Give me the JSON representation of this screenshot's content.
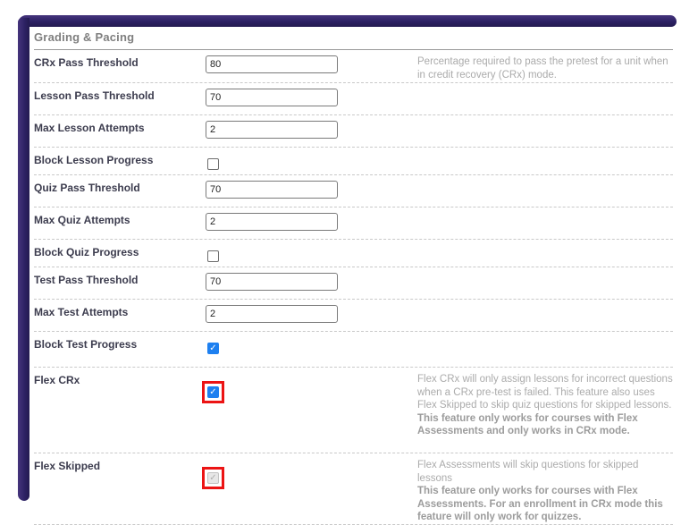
{
  "colors": {
    "frame_purple": "#2c2163",
    "checkbox_blue": "#1e80f0",
    "highlight_red": "#ec1414",
    "label_text": "#3c3c4e",
    "help_text": "#ababab",
    "title_text": "#7f7f7f"
  },
  "panel": {
    "title": "Grading & Pacing",
    "rows": [
      {
        "id": "crx_pass_threshold",
        "label": "CRx Pass Threshold",
        "type": "text",
        "value": "80",
        "help": [
          {
            "text": "Percentage required to pass the pretest for a unit when in credit recovery (CRx) mode.",
            "bold": false
          }
        ]
      },
      {
        "id": "lesson_pass_threshold",
        "label": "Lesson Pass Threshold",
        "type": "text",
        "value": "70",
        "help": []
      },
      {
        "id": "max_lesson_attempts",
        "label": "Max Lesson Attempts",
        "type": "text",
        "value": "2",
        "help": []
      },
      {
        "id": "block_lesson_progress",
        "label": "Block Lesson Progress",
        "type": "checkbox",
        "checked": false,
        "disabled": false,
        "highlighted": false,
        "help": []
      },
      {
        "id": "quiz_pass_threshold",
        "label": "Quiz Pass Threshold",
        "type": "text",
        "value": "70",
        "help": []
      },
      {
        "id": "max_quiz_attempts",
        "label": "Max Quiz Attempts",
        "type": "text",
        "value": "2",
        "help": []
      },
      {
        "id": "block_quiz_progress",
        "label": "Block Quiz Progress",
        "type": "checkbox",
        "checked": false,
        "disabled": false,
        "highlighted": false,
        "help": []
      },
      {
        "id": "test_pass_threshold",
        "label": "Test Pass Threshold",
        "type": "text",
        "value": "70",
        "help": []
      },
      {
        "id": "max_test_attempts",
        "label": "Max Test Attempts",
        "type": "text",
        "value": "2",
        "help": []
      },
      {
        "id": "block_test_progress",
        "label": "Block Test Progress",
        "type": "checkbox",
        "checked": true,
        "disabled": false,
        "highlighted": false,
        "help": []
      },
      {
        "id": "flex_crx",
        "label": "Flex CRx",
        "type": "checkbox",
        "checked": true,
        "disabled": false,
        "highlighted": true,
        "help": [
          {
            "text": "Flex CRx will only assign lessons for incorrect questions when a CRx pre-test is failed. This feature also uses Flex Skipped to skip quiz questions for skipped lessons.",
            "bold": false
          },
          {
            "text": "This feature only works for courses with Flex Assessments and only works in CRx mode.",
            "bold": true
          }
        ]
      },
      {
        "id": "flex_skipped",
        "label": "Flex Skipped",
        "type": "checkbox",
        "checked": true,
        "disabled": true,
        "highlighted": true,
        "help": [
          {
            "text": "Flex Assessments will skip questions for skipped lessons",
            "bold": false
          },
          {
            "text": "This feature only works for courses with Flex Assessments. For an enrollment in CRx mode this feature will only work for quizzes.",
            "bold": true
          }
        ]
      }
    ]
  },
  "icons": {
    "checkmark": "✓"
  }
}
